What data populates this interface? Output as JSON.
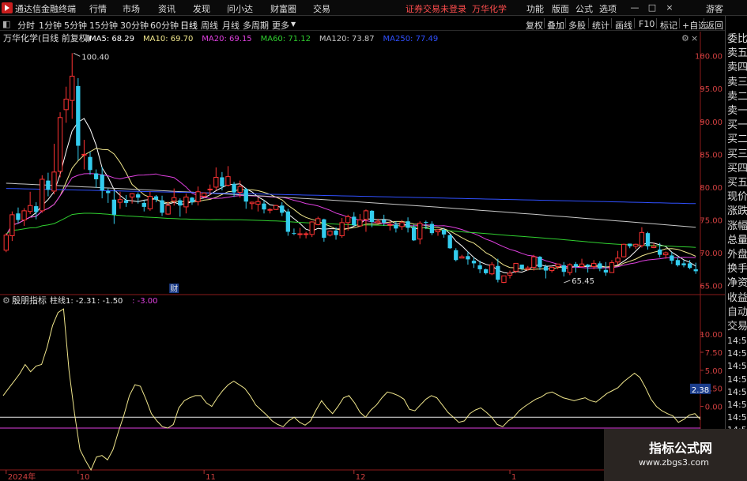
{
  "app": {
    "title": "通达信金融终端",
    "notice": "证券交易未登录",
    "stock": "万华化学",
    "user": "游客"
  },
  "menu": [
    "行情",
    "市场",
    "资讯",
    "发现",
    "问小达",
    "财富圈",
    "交易"
  ],
  "right_menu": [
    "功能",
    "版面",
    "公式",
    "选项"
  ],
  "window_buttons": [
    "—",
    "□",
    "×"
  ],
  "corner_badge": {
    "top": "R",
    "bottom": "300"
  },
  "periods": [
    "分时",
    "1分钟",
    "5分钟",
    "15分钟",
    "30分钟",
    "60分钟",
    "日线",
    "周线",
    "月线",
    "多周期",
    "更多"
  ],
  "active_period": "日线",
  "toolbar": [
    "复权",
    "叠加",
    "多股",
    "统计",
    "画线",
    "F10",
    "标记",
    "+自选",
    "返回"
  ],
  "chart_header": {
    "name": "万华化学(日线 前复权)",
    "ma": [
      {
        "label": "MA5: 68.29",
        "color": "#ffffff"
      },
      {
        "label": "MA10: 69.70",
        "color": "#f0e68c"
      },
      {
        "label": "MA20: 69.15",
        "color": "#e040e0"
      },
      {
        "label": "MA60: 71.12",
        "color": "#30d030"
      },
      {
        "label": "MA120: 73.87",
        "color": "#c8c8c8"
      },
      {
        "label": "MA250: 77.49",
        "color": "#3050ff"
      }
    ]
  },
  "indicator_header": {
    "name": "殷朋指标",
    "labels": [
      {
        "text": "柱线1: -2.31",
        "color": "#e8e8e8"
      },
      {
        "text": ": -1.50",
        "color": "#e8e8e8"
      },
      {
        "text": ": -3.00",
        "color": "#e040e0"
      }
    ]
  },
  "right_panel": [
    "委比",
    "卖五",
    "卖四",
    "卖三",
    "卖二",
    "卖一",
    "买一",
    "买二",
    "买三",
    "买四",
    "买五",
    "现价",
    "涨跌",
    "涨幅",
    "总量",
    "外盘",
    "换手",
    "净资",
    "收益",
    "自动",
    "交易"
  ],
  "right_times": [
    "14:56",
    "14:56",
    "14:56",
    "14:56",
    "14:56",
    "14:56",
    "14:56",
    "14:56",
    "14:56",
    "14:56"
  ],
  "chart_data": [
    {
      "type": "candlestick",
      "title": "万华化学(日线 前复权)",
      "ylim": [
        64,
        102
      ],
      "yticks": [
        65.0,
        70.0,
        75.0,
        80.0,
        85.0,
        90.0,
        95.0,
        100.0
      ],
      "annotations": [
        {
          "text": "100.40",
          "x": 11,
          "y": 100.4
        },
        {
          "text": "65.45",
          "x": 93,
          "y": 65.45
        },
        {
          "text": "财",
          "x": 28
        }
      ],
      "x_labels": [
        {
          "text": "2024年",
          "x": 0
        },
        {
          "text": "10",
          "x": 12
        },
        {
          "text": "11",
          "x": 33
        },
        {
          "text": "12",
          "x": 58
        },
        {
          "text": "1",
          "x": 84
        },
        {
          "text": "2",
          "x": 104
        }
      ],
      "candles": [
        [
          70.4,
          73.0,
          70.1,
          72.7
        ],
        [
          72.6,
          76.3,
          71.8,
          75.8
        ],
        [
          76.0,
          76.9,
          74.5,
          75.0
        ],
        [
          75.0,
          76.8,
          74.1,
          76.4
        ],
        [
          76.3,
          79.3,
          75.9,
          77.2
        ],
        [
          77.1,
          77.7,
          75.1,
          76.2
        ],
        [
          76.4,
          81.8,
          76.1,
          81.2
        ],
        [
          81.0,
          82.2,
          78.6,
          79.6
        ],
        [
          79.4,
          86.6,
          78.9,
          82.3
        ],
        [
          82.4,
          91.4,
          81.5,
          90.6
        ],
        [
          91.8,
          95.3,
          89.8,
          93.4
        ],
        [
          93.2,
          100.4,
          90.4,
          96.9
        ],
        [
          95.4,
          96.6,
          84.1,
          86.3
        ],
        [
          84.9,
          87.2,
          82.7,
          85.0
        ],
        [
          84.6,
          85.4,
          81.9,
          82.6
        ],
        [
          82.1,
          82.7,
          79.9,
          81.2
        ],
        [
          81.9,
          83.1,
          78.3,
          79.5
        ],
        [
          79.4,
          79.8,
          77.6,
          79.1
        ],
        [
          78.1,
          79.5,
          74.4,
          75.8
        ],
        [
          77.7,
          79.3,
          76.7,
          78.1
        ],
        [
          78.0,
          78.8,
          77.0,
          77.6
        ],
        [
          78.5,
          79.1,
          77.5,
          79.0
        ],
        [
          78.9,
          79.2,
          77.5,
          78.4
        ],
        [
          77.6,
          78.0,
          76.3,
          77.0
        ],
        [
          76.7,
          79.3,
          76.4,
          78.6
        ],
        [
          78.6,
          78.8,
          77.7,
          78.1
        ],
        [
          78.0,
          78.7,
          75.6,
          76.1
        ],
        [
          75.9,
          77.8,
          75.8,
          77.2
        ],
        [
          77.9,
          79.8,
          77.2,
          78.4
        ],
        [
          78.0,
          78.3,
          75.5,
          77.2
        ],
        [
          77.0,
          79.0,
          76.0,
          78.5
        ],
        [
          78.4,
          78.5,
          77.3,
          77.7
        ],
        [
          77.8,
          80.1,
          77.2,
          79.3
        ],
        [
          78.6,
          79.2,
          78.4,
          79.1
        ],
        [
          79.6,
          80.4,
          78.8,
          79.7
        ],
        [
          80.0,
          83.0,
          79.5,
          81.5
        ],
        [
          81.5,
          82.3,
          79.5,
          80.1
        ],
        [
          80.3,
          83.2,
          80.1,
          81.6
        ],
        [
          80.5,
          80.8,
          78.5,
          79.2
        ],
        [
          79.2,
          81.0,
          78.4,
          80.1
        ],
        [
          79.7,
          79.9,
          76.7,
          77.8
        ],
        [
          77.5,
          77.8,
          76.6,
          77.7
        ],
        [
          77.4,
          78.4,
          76.3,
          77.8
        ],
        [
          77.5,
          78.0,
          76.0,
          76.6
        ],
        [
          76.6,
          76.8,
          76.0,
          76.6
        ],
        [
          76.6,
          77.3,
          76.5,
          77.2
        ],
        [
          77.2,
          77.7,
          75.6,
          76.1
        ],
        [
          76.3,
          76.7,
          72.6,
          73.2
        ],
        [
          73.0,
          73.7,
          72.7,
          72.9
        ],
        [
          72.9,
          73.8,
          72.2,
          72.9
        ],
        [
          72.8,
          73.2,
          72.2,
          72.9
        ],
        [
          72.8,
          74.8,
          72.4,
          74.7
        ],
        [
          74.3,
          75.5,
          74.2,
          75.2
        ],
        [
          75.1,
          75.2,
          71.7,
          72.3
        ],
        [
          72.7,
          73.4,
          72.5,
          73.3
        ],
        [
          73.4,
          73.9,
          72.0,
          72.7
        ],
        [
          72.6,
          75.3,
          72.3,
          74.6
        ],
        [
          74.6,
          75.8,
          73.4,
          75.5
        ],
        [
          75.5,
          76.2,
          74.1,
          74.2
        ],
        [
          74.1,
          75.9,
          74.0,
          75.0
        ],
        [
          75.1,
          76.6,
          73.2,
          76.4
        ],
        [
          76.4,
          76.5,
          73.9,
          74.7
        ],
        [
          74.6,
          75.2,
          74.4,
          74.8
        ],
        [
          75.0,
          75.8,
          74.1,
          74.6
        ],
        [
          74.3,
          74.8,
          73.4,
          74.3
        ],
        [
          74.3,
          74.8,
          73.1,
          73.7
        ],
        [
          74.0,
          75.0,
          73.5,
          74.6
        ],
        [
          74.8,
          75.4,
          73.1,
          73.8
        ],
        [
          73.9,
          74.3,
          71.8,
          71.9
        ],
        [
          72.1,
          74.8,
          71.3,
          74.5
        ],
        [
          74.7,
          74.9,
          73.6,
          74.6
        ],
        [
          74.4,
          74.8,
          72.7,
          73.0
        ],
        [
          73.2,
          73.6,
          72.6,
          73.5
        ],
        [
          73.5,
          73.8,
          72.3,
          72.8
        ],
        [
          72.7,
          72.8,
          70.6,
          70.7
        ],
        [
          70.4,
          70.7,
          68.7,
          68.9
        ],
        [
          69.2,
          69.7,
          69.2,
          69.4
        ],
        [
          69.5,
          70.2,
          68.2,
          69.0
        ],
        [
          68.8,
          69.3,
          67.7,
          68.4
        ],
        [
          68.1,
          68.8,
          66.9,
          67.5
        ],
        [
          67.5,
          67.6,
          66.7,
          66.9
        ],
        [
          66.8,
          68.6,
          66.6,
          68.2
        ],
        [
          68.0,
          69.1,
          65.5,
          65.9
        ],
        [
          65.5,
          66.5,
          65.4,
          66.5
        ],
        [
          66.6,
          67.3,
          66.1,
          66.9
        ],
        [
          67.2,
          68.4,
          66.9,
          68.4
        ],
        [
          68.2,
          68.2,
          67.3,
          67.6
        ],
        [
          67.5,
          68.0,
          67.3,
          67.7
        ],
        [
          67.8,
          69.7,
          67.3,
          69.4
        ],
        [
          69.4,
          69.5,
          67.4,
          67.8
        ],
        [
          67.9,
          68.2,
          66.1,
          67.3
        ],
        [
          67.3,
          67.8,
          67.0,
          67.8
        ],
        [
          67.9,
          68.3,
          67.5,
          68.3
        ],
        [
          68.1,
          68.6,
          66.4,
          67.1
        ],
        [
          67.0,
          68.4,
          66.6,
          68.2
        ],
        [
          68.3,
          68.6,
          67.0,
          67.9
        ],
        [
          67.9,
          69.1,
          67.8,
          68.3
        ],
        [
          68.2,
          68.3,
          67.0,
          67.9
        ],
        [
          67.9,
          68.9,
          67.5,
          68.4
        ],
        [
          68.4,
          68.7,
          67.2,
          67.6
        ],
        [
          67.4,
          68.6,
          66.5,
          67.0
        ],
        [
          67.0,
          68.9,
          67.0,
          68.5
        ],
        [
          68.6,
          70.3,
          68.2,
          69.2
        ],
        [
          69.4,
          71.4,
          69.3,
          71.3
        ],
        [
          71.4,
          71.4,
          70.7,
          71.0
        ],
        [
          71.0,
          71.4,
          70.6,
          71.3
        ],
        [
          71.1,
          73.9,
          70.8,
          73.1
        ],
        [
          73.0,
          73.2,
          70.5,
          71.0
        ],
        [
          70.8,
          71.5,
          70.7,
          71.0
        ],
        [
          70.5,
          71.5,
          69.3,
          69.7
        ],
        [
          69.7,
          70.2,
          69.1,
          70.0
        ],
        [
          69.6,
          70.1,
          68.3,
          68.8
        ],
        [
          68.9,
          69.3,
          67.9,
          68.1
        ],
        [
          68.4,
          68.9,
          67.8,
          68.1
        ],
        [
          68.4,
          68.9,
          67.5,
          67.7
        ],
        [
          67.5,
          68.5,
          66.8,
          67.2
        ]
      ]
    },
    {
      "type": "line",
      "title": "殷朋指标",
      "ylim": [
        -10.0,
        14.5
      ],
      "yticks": [
        -5.0,
        0.0,
        2.5,
        5.0,
        7.5,
        10.0
      ],
      "current_value": "2.38",
      "hlines": [
        {
          "name": "殷朋指标",
          "value": -1.5,
          "color": "#e8e8e8"
        },
        {
          "name": "殷朋指标",
          "value": -3.0,
          "color": "#e040e0"
        }
      ],
      "series": [
        {
          "name": "柱线1",
          "color": "#f0e68c",
          "values": [
            1.5,
            2.5,
            3.5,
            4.5,
            5.8,
            4.8,
            5.6,
            5.8,
            8.2,
            11.2,
            13.0,
            13.5,
            5.0,
            -1.0,
            -6.0,
            -7.5,
            -8.8,
            -7.0,
            -6.8,
            -7.4,
            -6.0,
            -3.5,
            -1.2,
            1.5,
            3.0,
            2.8,
            1.0,
            -1.0,
            -2.0,
            -2.8,
            -3.0,
            -2.5,
            -0.2,
            0.8,
            1.2,
            1.5,
            1.5,
            0.5,
            0.0,
            1.2,
            2.2,
            3.0,
            3.5,
            3.0,
            2.5,
            1.5,
            0.2,
            -0.5,
            -1.2,
            -2.0,
            -2.5,
            -2.8,
            -2.0,
            -1.5,
            -2.2,
            -2.6,
            -2.0,
            -0.5,
            0.8,
            -0.2,
            -1.0,
            0.0,
            1.2,
            1.5,
            0.5,
            -0.8,
            -1.5,
            -0.5,
            0.2,
            1.2,
            2.0,
            1.8,
            1.5,
            1.0,
            -0.4,
            -0.6,
            0.2,
            1.0,
            1.5,
            1.2,
            0.2,
            -0.8,
            -1.5,
            -2.2,
            -2.0,
            -1.0,
            -0.5,
            -0.2,
            -0.8,
            -1.5,
            -2.5,
            -2.8,
            -2.0,
            -1.5,
            -0.6,
            0.0,
            0.5,
            1.0,
            1.3,
            1.8,
            2.0,
            1.6,
            1.2,
            1.0,
            0.8,
            1.0,
            1.2,
            0.8,
            0.6,
            1.2,
            1.8,
            2.2,
            2.6,
            3.4,
            4.0,
            4.6,
            4.0,
            2.6,
            1.0,
            0.0,
            -0.6,
            -1.0,
            -1.3,
            -2.2,
            -1.8,
            -1.2,
            -1.0,
            -1.8
          ]
        }
      ]
    }
  ]
}
